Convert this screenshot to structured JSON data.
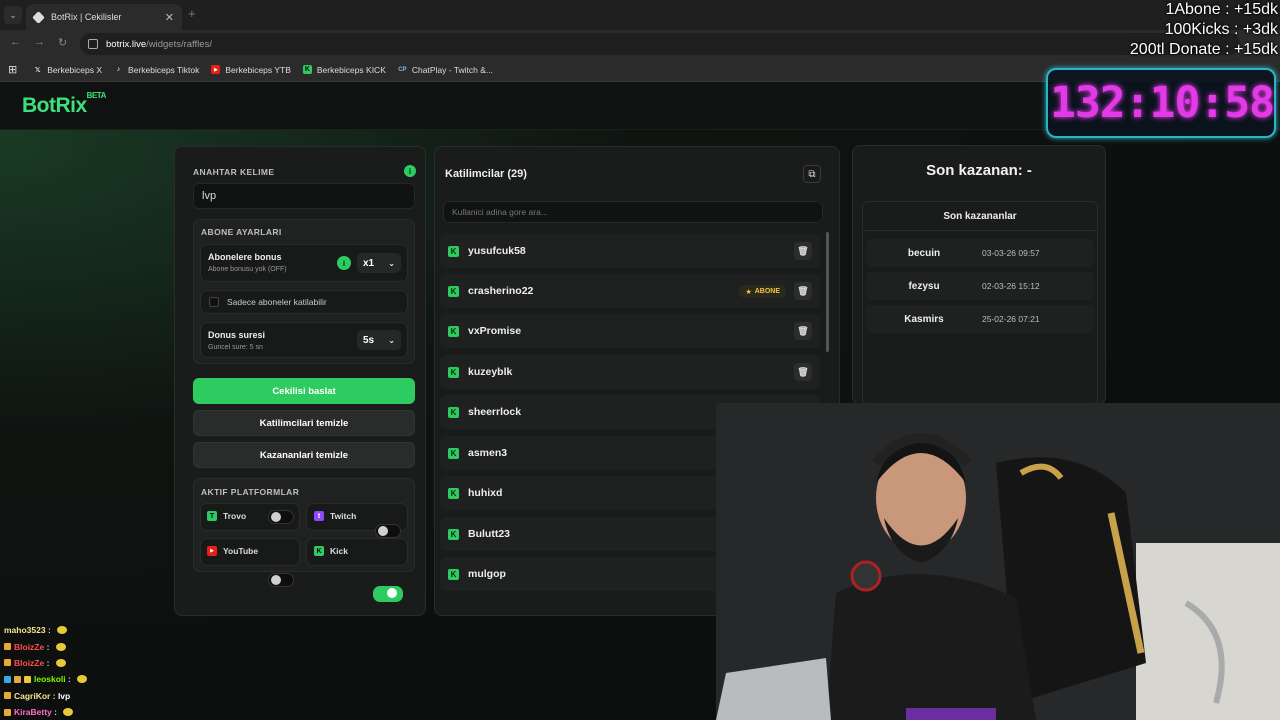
{
  "browser": {
    "tab_title": "BotRix | Cekilisler",
    "url_domain": "botrix.live",
    "url_path": "/widgets/raffles/",
    "bookmarks": [
      {
        "label": "Berkebiceps X",
        "icon": "x-icon"
      },
      {
        "label": "Berkebiceps Tiktok",
        "icon": "tiktok-icon"
      },
      {
        "label": "Berkebiceps YTB",
        "icon": "youtube-icon"
      },
      {
        "label": "Berkebiceps KICK",
        "icon": "kick-icon"
      },
      {
        "label": "ChatPlay - Twitch &...",
        "icon": "chatplay-icon"
      }
    ]
  },
  "app": {
    "logo": "BotRix",
    "logo_badge": "BETA"
  },
  "left_panel": {
    "keyword_label": "ANAHTAR KELIME",
    "keyword_value": "lvp",
    "sub_settings_label": "ABONE AYARLARI",
    "sub_bonus_title": "Abonelere bonus",
    "sub_bonus_sub": "Abone bonusu yok (OFF)",
    "sub_bonus_mult": "x1",
    "sub_only_label": "Sadece aboneler katilabilir",
    "bonus_time_title": "Donus suresi",
    "bonus_time_sub": "Guncel sure: 5 sn",
    "bonus_time_value": "5s",
    "start_button": "Cekilisi baslat",
    "clear_participants_button": "Katilimcilari temizle",
    "clear_winners_button": "Kazananlari temizle",
    "platforms_label": "AKTIF PLATFORMLAR",
    "platforms": [
      {
        "name": "Trovo",
        "on": false
      },
      {
        "name": "Twitch",
        "on": false
      },
      {
        "name": "YouTube",
        "on": false
      },
      {
        "name": "Kick",
        "on": true
      }
    ]
  },
  "participants": {
    "title": "Katilimcilar (29)",
    "search_placeholder": "Kullanici adina gore ara...",
    "badge_label": "ABONE",
    "list": [
      "yusufcuk58",
      "crasherino22",
      "vxPromise",
      "kuzeyblk",
      "sheerrlock",
      "asmen3",
      "huhixd",
      "Bulutt23",
      "mulgop"
    ]
  },
  "winners": {
    "last_winner": "Son kazanan: -",
    "recent_title": "Son kazananlar",
    "list": [
      {
        "name": "becuin",
        "date": "03-03-26 09:57"
      },
      {
        "name": "fezysu",
        "date": "02-03-26 15:12"
      },
      {
        "name": "Kasmirs",
        "date": "25-02-26 07:21"
      }
    ]
  },
  "overlay": {
    "line1": "1Abone : +15dk",
    "line2": "100Kicks : +3dk",
    "line3": "200tl Donate : +15dk",
    "timer": "132:10:58"
  },
  "chat": [
    {
      "user": "maho3523",
      "msg": "",
      "color": "#f0e68c"
    },
    {
      "user": "BloizZe",
      "msg": "",
      "color": "#ff4d4d"
    },
    {
      "user": "BloizZe",
      "msg": "",
      "color": "#ff4d4d"
    },
    {
      "user": "leoskoli",
      "msg": "",
      "color": "#7cfc00"
    },
    {
      "user": "CagriKor",
      "msg": "lvp",
      "color": "#f0e68c"
    },
    {
      "user": "KiraBetty",
      "msg": "",
      "color": "#ff6ec7"
    }
  ]
}
